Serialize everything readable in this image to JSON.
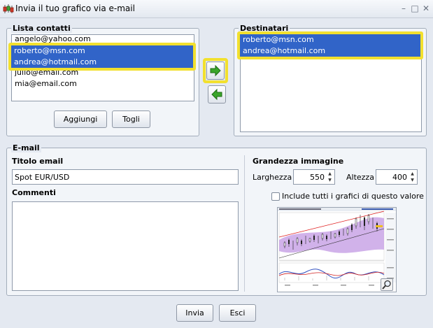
{
  "window": {
    "title": "Invia il tuo grafico via e-mail",
    "minimize_glyph": "–",
    "maximize_glyph": "□",
    "close_glyph": "✕"
  },
  "contacts": {
    "legend": "Lista contatti",
    "items": [
      "angelo@yahoo.com",
      "roberto@msn.com",
      "andrea@hotmail.com",
      "julio@email.com",
      "mia@email.com"
    ],
    "add_label": "Aggiungi",
    "remove_label": "Togli"
  },
  "recipients": {
    "legend": "Destinatari",
    "items": [
      "roberto@msn.com",
      "andrea@hotmail.com"
    ]
  },
  "email": {
    "legend": "E-mail",
    "title_label": "Titolo email",
    "title_value": "Spot EUR/USD",
    "comments_label": "Commenti",
    "comments_value": ""
  },
  "image_size": {
    "label": "Grandezza immagine",
    "width_label": "Larghezza",
    "width_value": "550",
    "height_label": "Altezza",
    "height_value": "400",
    "include_label": "Include tutti i grafici di questo valore",
    "include_checked": false
  },
  "footer": {
    "send_label": "Invia",
    "exit_label": "Esci"
  },
  "colors": {
    "selection": "#3164c8",
    "highlight": "#f2e02e",
    "arrow_green": "#3aa52a"
  }
}
